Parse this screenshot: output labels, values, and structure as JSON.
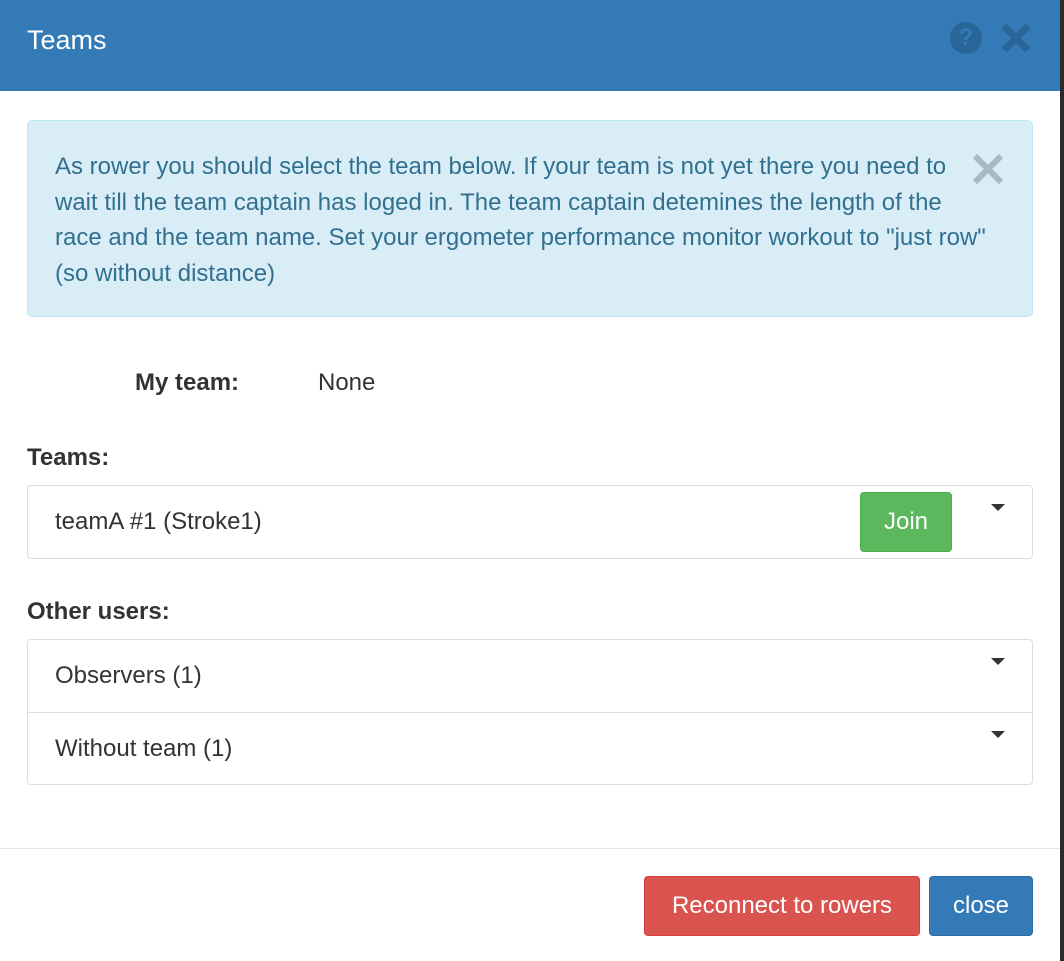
{
  "dialog": {
    "title": "Teams",
    "icons": {
      "help": "question-circle-icon",
      "close": "close-icon"
    }
  },
  "alert": {
    "text": "As rower you should select the team below. If your team is not yet there you need to wait till the team captain has loged in. The team captain detemines the length of the race and the team name. Set your ergometer performance monitor workout to \"just row\" (so without distance)"
  },
  "my_team": {
    "label": "My team:",
    "value": "None"
  },
  "teams": {
    "label": "Teams:",
    "items": [
      {
        "name": "teamA #1 (Stroke1)",
        "join_label": "Join"
      }
    ]
  },
  "other_users": {
    "label": "Other users:",
    "items": [
      {
        "name": "Observers (1)"
      },
      {
        "name": "Without team (1)"
      }
    ]
  },
  "footer": {
    "reconnect_label": "Reconnect to rowers",
    "close_label": "close"
  },
  "colors": {
    "header": "#337ab7",
    "alert_bg": "#d9edf7",
    "join": "#5cb85c",
    "danger": "#d9534f",
    "primary": "#337ab7"
  }
}
